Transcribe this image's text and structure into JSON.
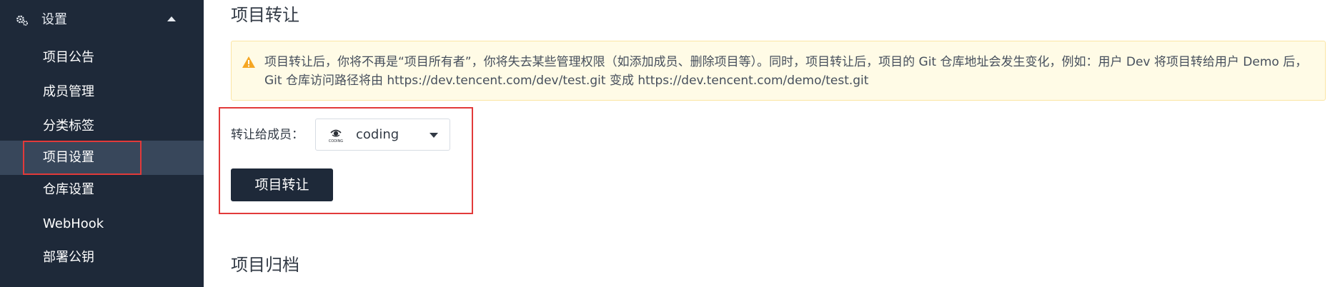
{
  "sidebar": {
    "title": "设置",
    "items": [
      {
        "label": "项目公告"
      },
      {
        "label": "成员管理"
      },
      {
        "label": "分类标签"
      },
      {
        "label": "项目设置",
        "active": true
      },
      {
        "label": "仓库设置"
      },
      {
        "label": "WebHook"
      },
      {
        "label": "部署公钥"
      }
    ]
  },
  "transfer": {
    "title": "项目转让",
    "alert_text": "项目转让后，你将不再是“项目所有者”，你将失去某些管理权限（如添加成员、删除项目等）。同时，项目转让后，项目的 Git 仓库地址会发生变化，例如：用户 Dev 将项目转给用户 Demo 后， Git 仓库访问路径将由 https://dev.tencent.com/dev/test.git 变成 https://dev.tencent.com/demo/test.git",
    "member_label": "转让给成员：",
    "member_value": "coding",
    "member_avatar_text": "CODING",
    "button_label": "项目转让"
  },
  "archive": {
    "title": "项目归档"
  },
  "colors": {
    "sidebar_bg": "#1e2939",
    "sidebar_active_bg": "#38475b",
    "highlight_border": "#e23a3a",
    "alert_bg": "#fffbe6",
    "alert_border": "#fbe5a3",
    "warning_icon": "#f5a623",
    "primary_button_bg": "#1e2939"
  },
  "icons": {
    "settings": "gears-icon",
    "collapse": "caret-up-icon",
    "warning": "warning-triangle-icon",
    "select": "caret-down-icon"
  }
}
